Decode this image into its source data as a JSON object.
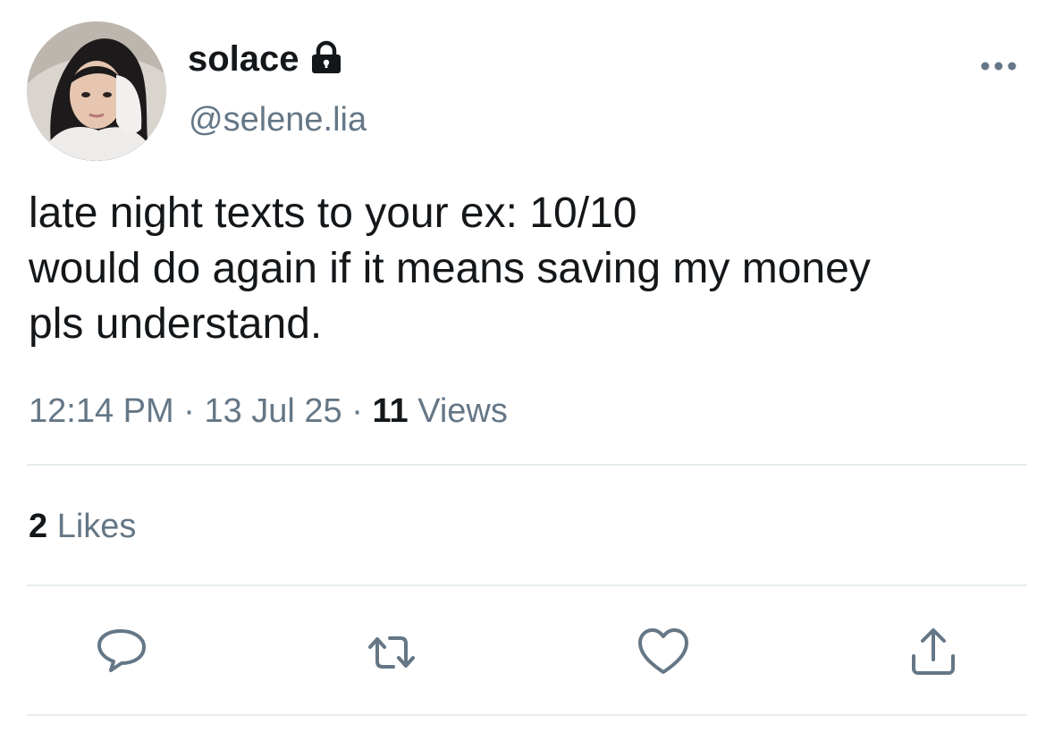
{
  "author": {
    "display_name": "solace",
    "handle": "@selene.lia",
    "avatar_icon": "profile-photo",
    "protected_icon": "lock-icon"
  },
  "menu": {
    "more_icon": "more-horizontal-icon"
  },
  "tweet": {
    "lines": [
      "late night texts to your ex: 10/10",
      "would do again if it means saving my money",
      "pls understand."
    ]
  },
  "meta": {
    "time": "12:14 PM",
    "separator": "·",
    "date": "13 Jul 25",
    "views_count": "11",
    "views_label": "Views"
  },
  "stats": {
    "likes_count": "2",
    "likes_label": "Likes"
  },
  "actions": [
    {
      "icon": "reply-icon"
    },
    {
      "icon": "retweet-icon"
    },
    {
      "icon": "like-icon"
    },
    {
      "icon": "share-icon"
    }
  ],
  "colors": {
    "primary_text": "#14171a",
    "secondary_text": "#657786",
    "divider": "#e6ecf0",
    "icon": "#657786"
  }
}
